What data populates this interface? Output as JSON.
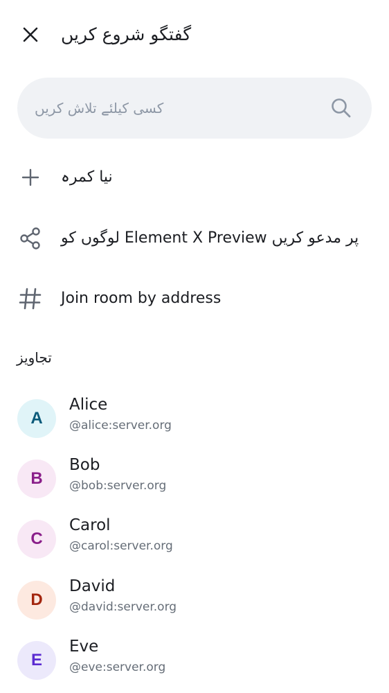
{
  "header": {
    "title": "گفتگو شروع کریں",
    "close_icon": "close-icon"
  },
  "search": {
    "placeholder": "کسی کیلئے تلاش کریں",
    "value": "",
    "icon": "search-icon"
  },
  "actions": [
    {
      "icon": "plus-icon",
      "label": "نیا کمرہ"
    },
    {
      "icon": "share-icon",
      "label": "لوگوں کو Element X Preview پر مدعو کریں"
    },
    {
      "icon": "hash-icon",
      "label": "Join room by address"
    }
  ],
  "suggestions": {
    "header": "تجاویز",
    "people": [
      {
        "initial": "A",
        "name": "Alice",
        "id": "@alice:server.org",
        "avatar_bg": "#e0f4f8",
        "avatar_fg": "#0a5a7a"
      },
      {
        "initial": "B",
        "name": "Bob",
        "id": "@bob:server.org",
        "avatar_bg": "#f8e8f5",
        "avatar_fg": "#8a1f8a"
      },
      {
        "initial": "C",
        "name": "Carol",
        "id": "@carol:server.org",
        "avatar_bg": "#f8e8f5",
        "avatar_fg": "#8a1f8a"
      },
      {
        "initial": "D",
        "name": "David",
        "id": "@david:server.org",
        "avatar_bg": "#fde9e0",
        "avatar_fg": "#a3260f"
      },
      {
        "initial": "E",
        "name": "Eve",
        "id": "@eve:server.org",
        "avatar_bg": "#ece9fb",
        "avatar_fg": "#5b2bd1"
      }
    ]
  }
}
